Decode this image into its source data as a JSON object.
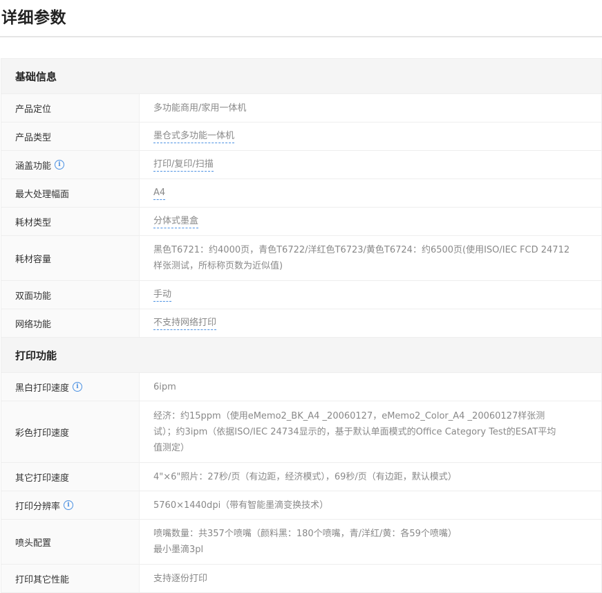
{
  "page": {
    "title": "详细参数"
  },
  "sections": [
    {
      "header": "基础信息",
      "rows": [
        {
          "label": "产品定位",
          "value": "多功能商用/家用一体机"
        },
        {
          "label": "产品类型",
          "value": "墨仓式多功能一体机"
        },
        {
          "label": "涵盖功能",
          "value": "打印/复印/扫描"
        },
        {
          "label": "最大处理幅面",
          "value": "A4"
        },
        {
          "label": "耗材类型",
          "value": "分体式墨盒"
        },
        {
          "label": "耗材容量",
          "value_lines": [
            "黑色T6721：约4000页，青色T6722/洋红色T6723/黄色T6724：约6500页(使用ISO/IEC FCD 24712",
            "样张测试，所标称页数为近似值)"
          ]
        },
        {
          "label": "双面功能",
          "value": "手动"
        },
        {
          "label": "网络功能",
          "value": "不支持网络打印"
        }
      ]
    },
    {
      "header": "打印功能",
      "rows": [
        {
          "label": "黑白打印速度",
          "value": "6ipm"
        },
        {
          "label": "彩色打印速度",
          "value_lines": [
            "经济：约15ppm（使用eMemo2_BK_A4 _20060127，eMemo2_Color_A4 _20060127样张测",
            "试）；约3ipm（依据ISO/IEC 24734显示的，基于默认单面模式的Office Category Test的ESAT平均",
            "值测定）"
          ]
        },
        {
          "label": "其它打印速度",
          "value": "4\"×6\"照片：27秒/页（有边距，经济模式），69秒/页（有边距，默认模式）"
        },
        {
          "label": "打印分辨率",
          "value": "5760×1440dpi（带有智能墨滴变换技术）"
        },
        {
          "label": "喷头配置",
          "value_lines": [
            "喷嘴数量：共357个喷嘴（颜料黑：180个喷嘴，青/洋红/黄：各59个喷嘴）",
            "最小墨滴3pl"
          ]
        },
        {
          "label": "打印其它性能",
          "value": "支持逐份打印"
        }
      ]
    }
  ],
  "icons": {
    "info": "info-icon",
    "info_glyph": "i"
  },
  "colors": {
    "accent": "#4a90e2",
    "section_bg": "#f5f5f5",
    "label_color": "#333333",
    "value_color": "#888888"
  }
}
